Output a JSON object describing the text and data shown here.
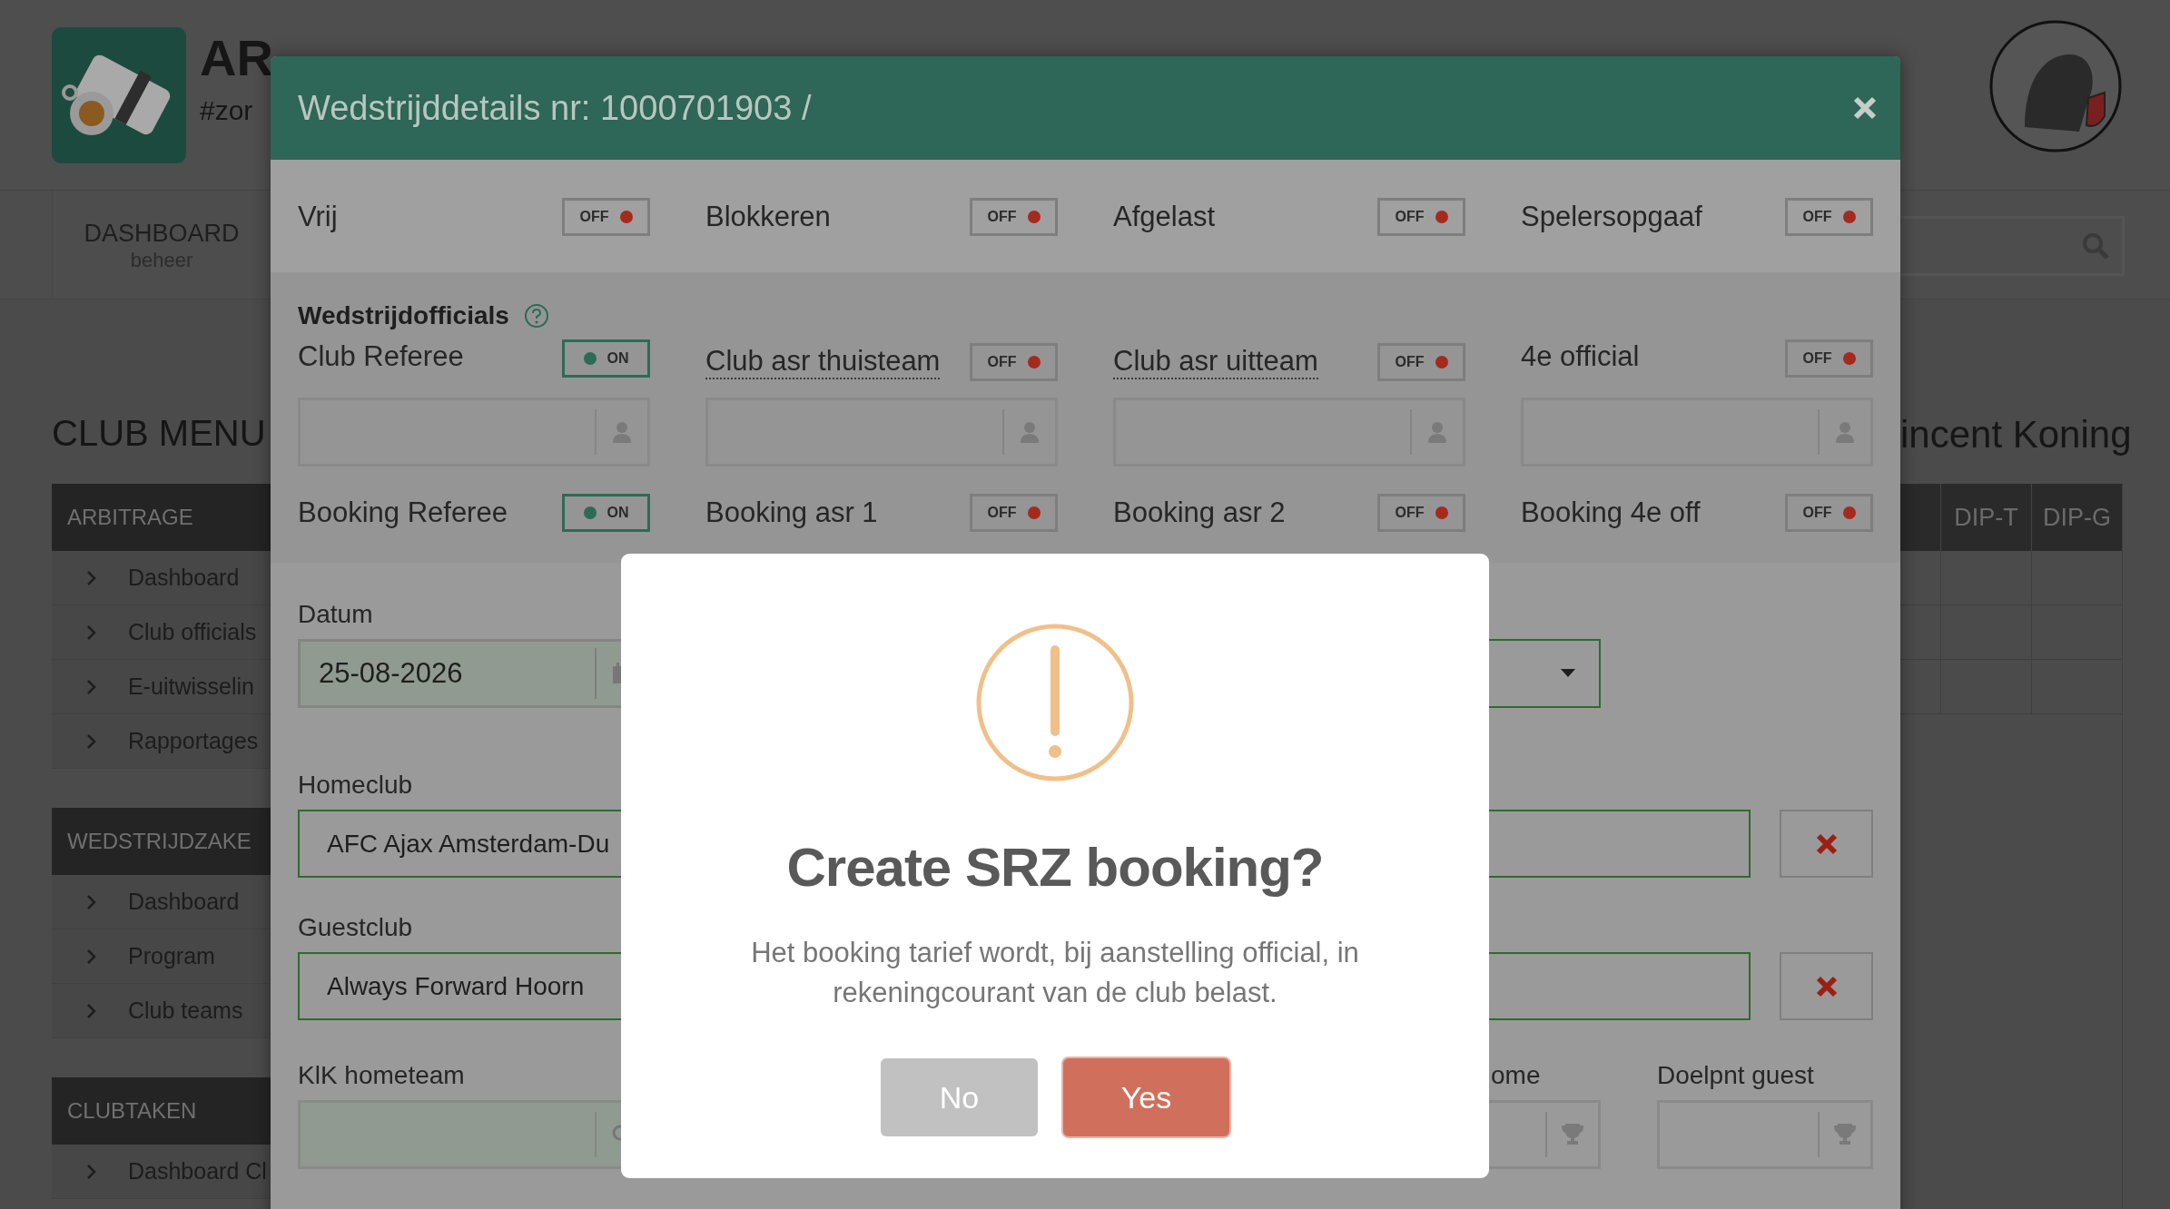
{
  "app": {
    "title": "AR",
    "tagline": "#zor"
  },
  "nav": [
    {
      "label": "DASHBOARD",
      "sublabel": "beheer"
    }
  ],
  "sidebar": {
    "title": "CLUB MENU",
    "sections": [
      {
        "header": "ARBITRAGE",
        "items": [
          "Dashboard",
          "Club officials",
          "E-uitwisselin",
          "Rapportages"
        ]
      },
      {
        "header": "WEDSTRIJDZAKE",
        "items": [
          "Dashboard",
          "Program",
          "Club teams"
        ]
      },
      {
        "header": "CLUBTAKEN",
        "items": [
          "Dashboard Cl"
        ]
      }
    ]
  },
  "user_name": "incent Koning",
  "table": {
    "columns": [
      "DIP-T",
      "DIP-G"
    ]
  },
  "modal": {
    "title": "Wedstrijddetails nr: 1000701903 /",
    "flags": [
      {
        "label": "Vrij",
        "on": false,
        "toggle_text": "OFF"
      },
      {
        "label": "Blokkeren",
        "on": false,
        "toggle_text": "OFF"
      },
      {
        "label": "Afgelast",
        "on": false,
        "toggle_text": "OFF"
      },
      {
        "label": "Spelersopgaaf",
        "on": false,
        "toggle_text": "OFF"
      }
    ],
    "officials": {
      "title": "Wedstrijdofficials",
      "roles": [
        {
          "label": "Club Referee",
          "on": true,
          "toggle_text": "ON",
          "dotted_underline": false
        },
        {
          "label": "Club asr thuisteam",
          "on": false,
          "toggle_text": "OFF",
          "dotted_underline": true
        },
        {
          "label": "Club asr uitteam",
          "on": false,
          "toggle_text": "OFF",
          "dotted_underline": true
        },
        {
          "label": "4e official",
          "on": false,
          "toggle_text": "OFF",
          "dotted_underline": false
        }
      ],
      "bookings": [
        {
          "label": "Booking Referee",
          "on": true,
          "toggle_text": "ON"
        },
        {
          "label": "Booking asr 1",
          "on": false,
          "toggle_text": "OFF"
        },
        {
          "label": "Booking asr 2",
          "on": false,
          "toggle_text": "OFF"
        },
        {
          "label": "Booking 4e off",
          "on": false,
          "toggle_text": "OFF"
        }
      ]
    },
    "datum": {
      "label": "Datum",
      "value": "25-08-2026"
    },
    "homeclub": {
      "label": "Homeclub",
      "value": "AFC Ajax Amsterdam-Du"
    },
    "guestclub": {
      "label": "Guestclub",
      "value": "Always Forward Hoorn"
    },
    "bottom_fields": [
      {
        "label": "KlK hometeam",
        "kind": "search"
      },
      {
        "label": "ome",
        "kind": "trophy"
      },
      {
        "label": "Doelpnt guest",
        "kind": "trophy"
      }
    ]
  },
  "dialog": {
    "title": "Create SRZ booking?",
    "text": "Het booking tarief wordt, bij aanstelling official, in rekeningcourant van de club belast.",
    "buttons": [
      {
        "label": "No",
        "kind": "cancel"
      },
      {
        "label": "Yes",
        "kind": "confirm"
      }
    ]
  }
}
